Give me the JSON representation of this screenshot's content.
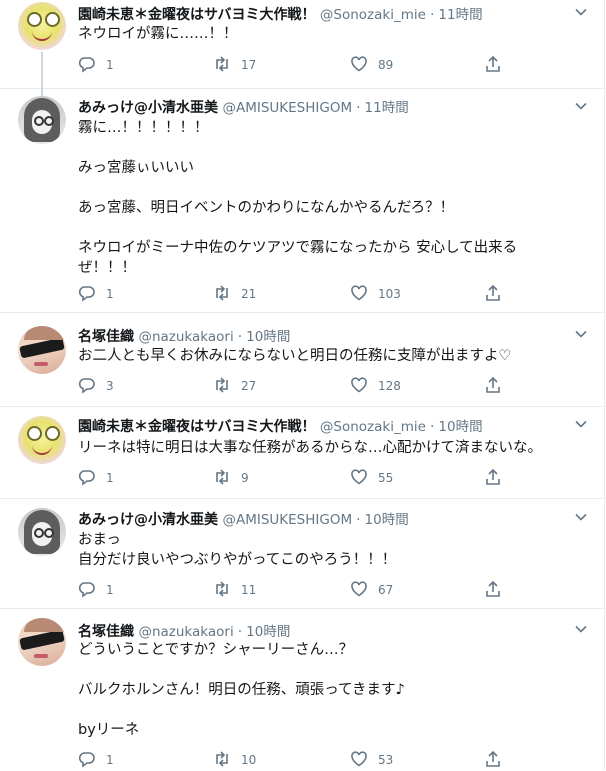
{
  "tweets": [
    {
      "name": "園崎未恵＊金曜夜はサバヨミ大作戦！",
      "handle": "@Sonozaki_mie",
      "time": "11時間",
      "text": "ネウロイが霧に……！！",
      "replies": "1",
      "retweets": "17",
      "likes": "89",
      "avatar": "frog-avatar"
    },
    {
      "name": "あみっけ@小清水亜美",
      "handle": "@AMISUKESHIGOM",
      "time": "11時間",
      "text": "霧に…！！！！！！\n\nみっ宮藤ぃいいい\n\nあっ宮藤、明日イベントのかわりになんかやるんだろ？！\n\nネウロイがミーナ中佐のケツアツで霧になったから 安心して出来る\nぜ！！！",
      "replies": "1",
      "retweets": "21",
      "likes": "103",
      "avatar": "drawn-girl-avatar"
    },
    {
      "name": "名塚佳織",
      "handle": "@nazukakaori",
      "time": "10時間",
      "text": "お二人とも早くお休みにならないと明日の任務に支障が出ますよ♡",
      "replies": "3",
      "retweets": "27",
      "likes": "128",
      "avatar": "glasses-avatar"
    },
    {
      "name": "園崎未恵＊金曜夜はサバヨミ大作戦！",
      "handle": "@Sonozaki_mie",
      "time": "10時間",
      "text": "リーネは特に明日は大事な任務があるからな…心配かけて済まないな。",
      "replies": "1",
      "retweets": "9",
      "likes": "55",
      "avatar": "frog-avatar"
    },
    {
      "name": "あみっけ@小清水亜美",
      "handle": "@AMISUKESHIGOM",
      "time": "10時間",
      "text": "おまっ\n自分だけ良いやつぶりやがってこのやろう！！！",
      "replies": "1",
      "retweets": "11",
      "likes": "67",
      "avatar": "drawn-girl-avatar"
    },
    {
      "name": "名塚佳織",
      "handle": "@nazukakaori",
      "time": "10時間",
      "text": "どういうことですか？シャーリーさん…？\n\nバルクホルンさん！明日の任務、頑張ってきます♪\n\nbyリーネ",
      "replies": "1",
      "retweets": "10",
      "likes": "53",
      "avatar": "glasses-avatar"
    }
  ],
  "colors": {
    "text": "#14171a",
    "secondary": "#657786",
    "divider": "#e6ecf0",
    "thread_line": "#ccd6dd"
  },
  "icons": [
    "reply-icon",
    "retweet-icon",
    "like-icon",
    "share-icon",
    "chevron-down-icon"
  ]
}
